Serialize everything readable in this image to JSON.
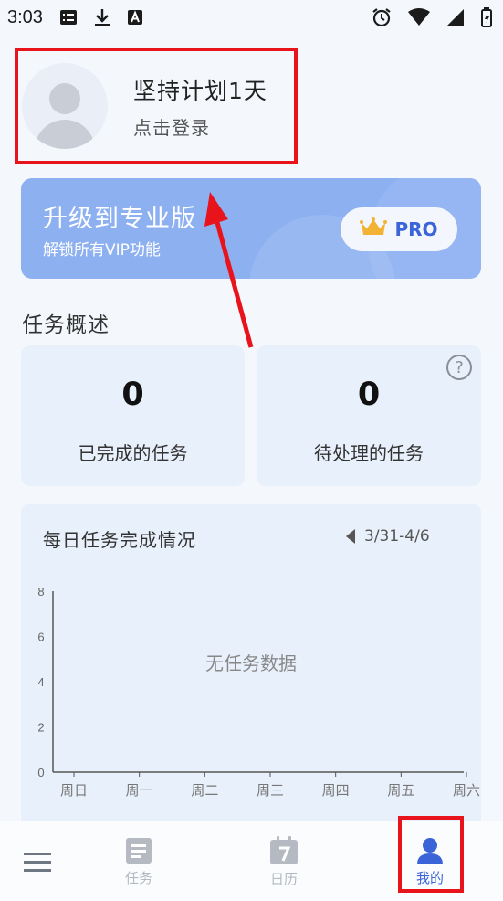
{
  "status_bar": {
    "time": "3:03"
  },
  "profile": {
    "title": "坚持计划1天",
    "subtitle": "点击登录"
  },
  "upgrade": {
    "title": "升级到专业版",
    "subtitle": "解锁所有VIP功能",
    "pro_label": "PRO"
  },
  "overview": {
    "title": "任务概述",
    "completed_value": "0",
    "completed_label": "已完成的任务",
    "pending_value": "0",
    "pending_label": "待处理的任务"
  },
  "daily_chart": {
    "title": "每日任务完成情况",
    "date_range": "3/31-4/6",
    "empty_text": "无任务数据"
  },
  "chart_data": {
    "type": "bar",
    "categories": [
      "周日",
      "周一",
      "周二",
      "周三",
      "周四",
      "周五",
      "周六"
    ],
    "values": [],
    "y_ticks": [
      0,
      2,
      4,
      6,
      8
    ],
    "ylim": [
      0,
      8
    ]
  },
  "bottom_nav": {
    "items": [
      {
        "label": "",
        "icon": "menu-icon"
      },
      {
        "label": "任务",
        "icon": "task-icon"
      },
      {
        "label": "日历",
        "icon": "calendar-icon"
      },
      {
        "label": "我的",
        "icon": "person-icon"
      }
    ]
  },
  "colors": {
    "accent": "#3a64d8",
    "banner": "#8db0f1",
    "highlight": "#e8131b"
  }
}
